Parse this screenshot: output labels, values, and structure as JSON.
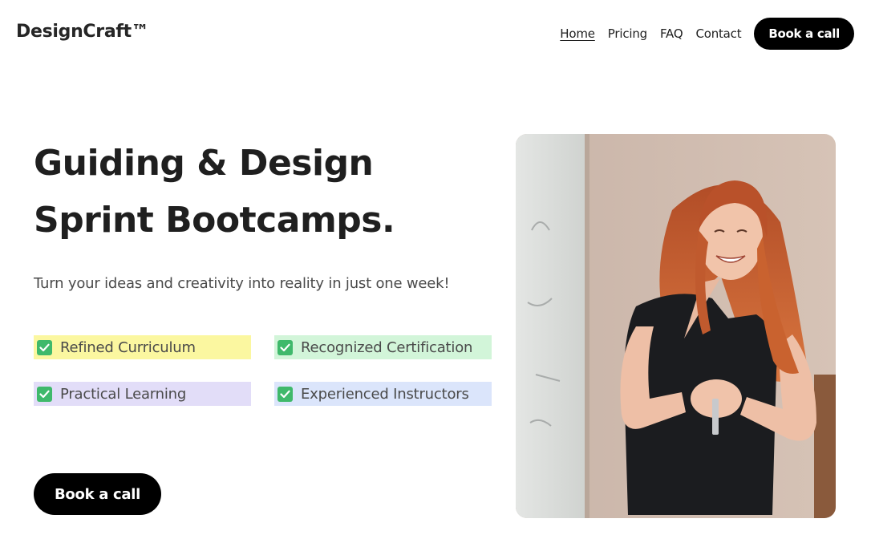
{
  "brand": {
    "name": "DesignCraft™"
  },
  "nav": {
    "links": [
      "Home",
      "Pricing",
      "FAQ",
      "Contact"
    ],
    "cta": "Book a call"
  },
  "hero": {
    "title_line1": "Guiding & Design",
    "title_line2": "Sprint Bootcamps.",
    "subtitle": "Turn your ideas and creativity into reality in just one week!",
    "features": [
      "Refined Curriculum",
      "Recognized Certification",
      "Practical Learning",
      "Experienced Instructors"
    ],
    "feature_icon": "check-icon",
    "cta": "Book a call"
  },
  "colors": {
    "button": "#000000",
    "feature_1_bg": "#fbf7a0",
    "feature_2_bg": "#d2f5d9",
    "feature_3_bg": "#e2ddf8",
    "feature_4_bg": "#dbe5fb",
    "check": "#3fb96b"
  }
}
